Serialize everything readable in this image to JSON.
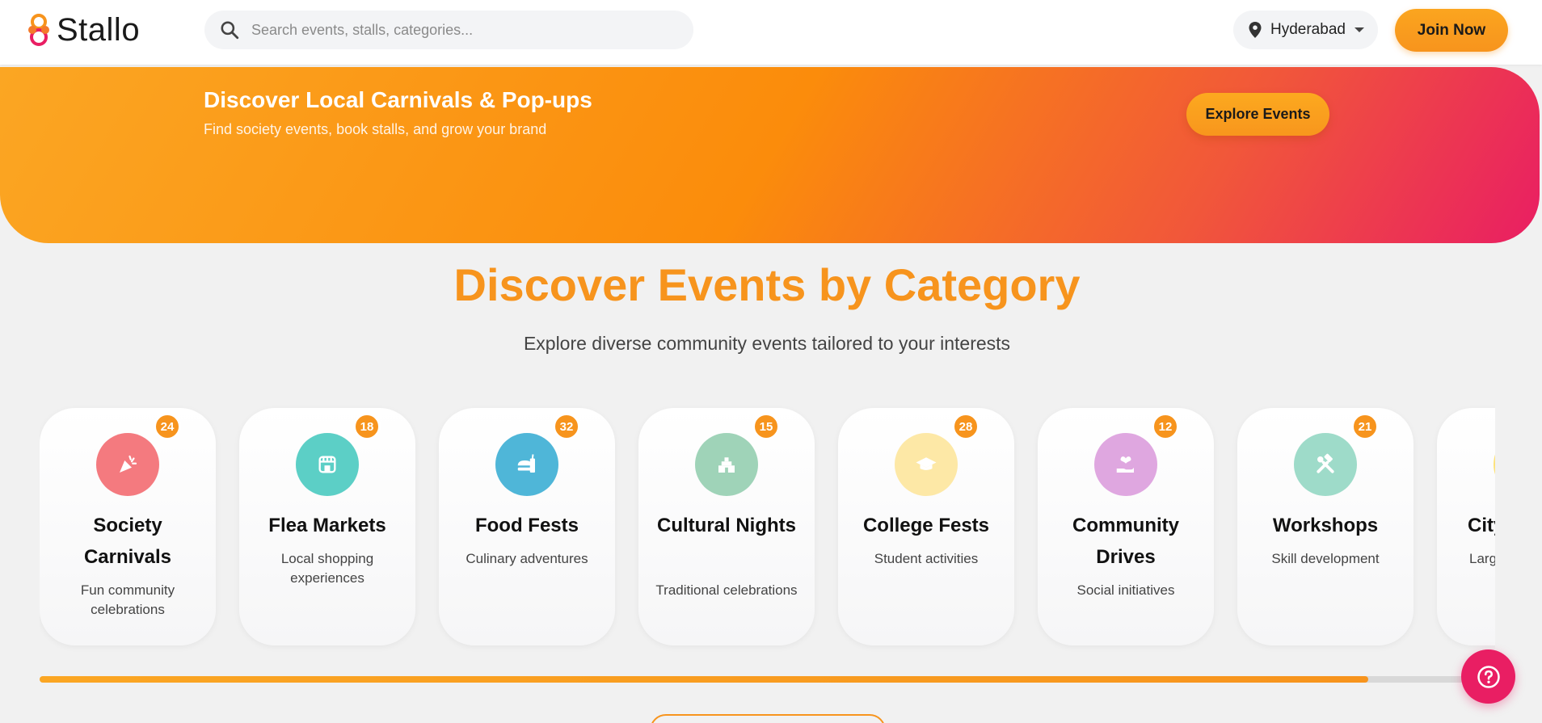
{
  "header": {
    "logo_text": "Stallo",
    "search_placeholder": "Search events, stalls, categories...",
    "location": "Hyderabad",
    "join_label": "Join Now"
  },
  "hero": {
    "title": "Discover Local Carnivals & Pop-ups",
    "subtitle": "Find society events, book stalls, and grow your brand",
    "cta_label": "Explore Events"
  },
  "section": {
    "title": "Discover Events by Category",
    "subtitle": "Explore diverse community events tailored to your interests"
  },
  "categories": [
    {
      "name": "Society Carnivals",
      "desc": "Fun community celebrations",
      "count": "24",
      "icon": "party-popper-icon",
      "color": "#f47a7f"
    },
    {
      "name": "Flea Markets",
      "desc": "Local shopping experiences",
      "count": "18",
      "icon": "storefront-icon",
      "color": "#5ccfc6"
    },
    {
      "name": "Food Fests",
      "desc": "Culinary adventures",
      "count": "32",
      "icon": "fast-food-icon",
      "color": "#4fb6d8"
    },
    {
      "name": "Cultural Nights",
      "desc": "Traditional celebrations",
      "count": "15",
      "icon": "temple-icon",
      "color": "#9fd3b8"
    },
    {
      "name": "College Fests",
      "desc": "Student activities",
      "count": "28",
      "icon": "graduation-cap-icon",
      "color": "#fde8a6"
    },
    {
      "name": "Community Drives",
      "desc": "Social initiatives",
      "count": "12",
      "icon": "charity-hand-icon",
      "color": "#dfa7e0"
    },
    {
      "name": "Workshops",
      "desc": "Skill development",
      "count": "21",
      "icon": "tools-icon",
      "color": "#9edbc9"
    },
    {
      "name": "City",
      "desc": "Larg",
      "count": "",
      "icon": "city-icon",
      "color": "#fde27a"
    }
  ],
  "scroll_progress": 0.913,
  "colors": {
    "accent": "#f7941d",
    "pink": "#e91e63"
  }
}
